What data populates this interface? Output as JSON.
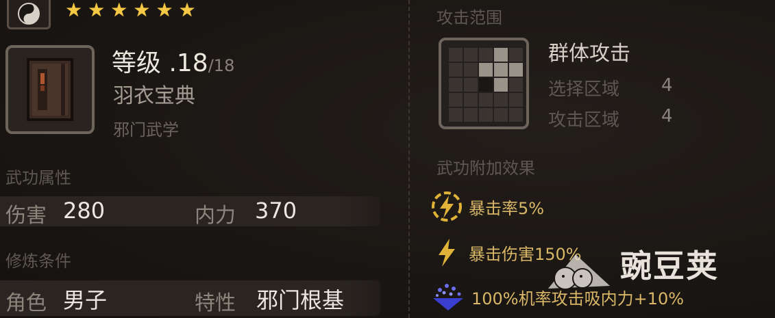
{
  "header": {
    "stars": 6,
    "star_color": "#f5c945"
  },
  "item": {
    "level_label": "等级",
    "level_sep": " .",
    "level_value": "18",
    "level_max": "/18",
    "name": "羽衣宝典",
    "type": "邪门武学"
  },
  "attributes": {
    "title": "武功属性",
    "damage_label": "伤害",
    "damage_value": "280",
    "inner_label": "内力",
    "inner_value": "370"
  },
  "requirements": {
    "title": "修炼条件",
    "role_label": "角色",
    "role_value": "男子",
    "trait_label": "特性",
    "trait_value": "邪门根基"
  },
  "attack_range": {
    "title": "攻击范围",
    "type": "群体攻击",
    "select_label": "选择区域",
    "select_value": "4",
    "attack_label": "攻击区域",
    "attack_value": "4"
  },
  "effects": {
    "title": "武功附加效果",
    "items": [
      {
        "icon": "crit-rate-icon",
        "text": "暴击率5%"
      },
      {
        "icon": "lightning-icon",
        "text": "暴击伤害150%"
      },
      {
        "icon": "absorb-icon",
        "text": "100%机率攻击吸内力+10%"
      }
    ]
  },
  "watermark": {
    "text": "豌豆荚"
  },
  "colors": {
    "gold_text": "#d9b767",
    "accent_star": "#f5c945",
    "background": "#1a1613"
  }
}
